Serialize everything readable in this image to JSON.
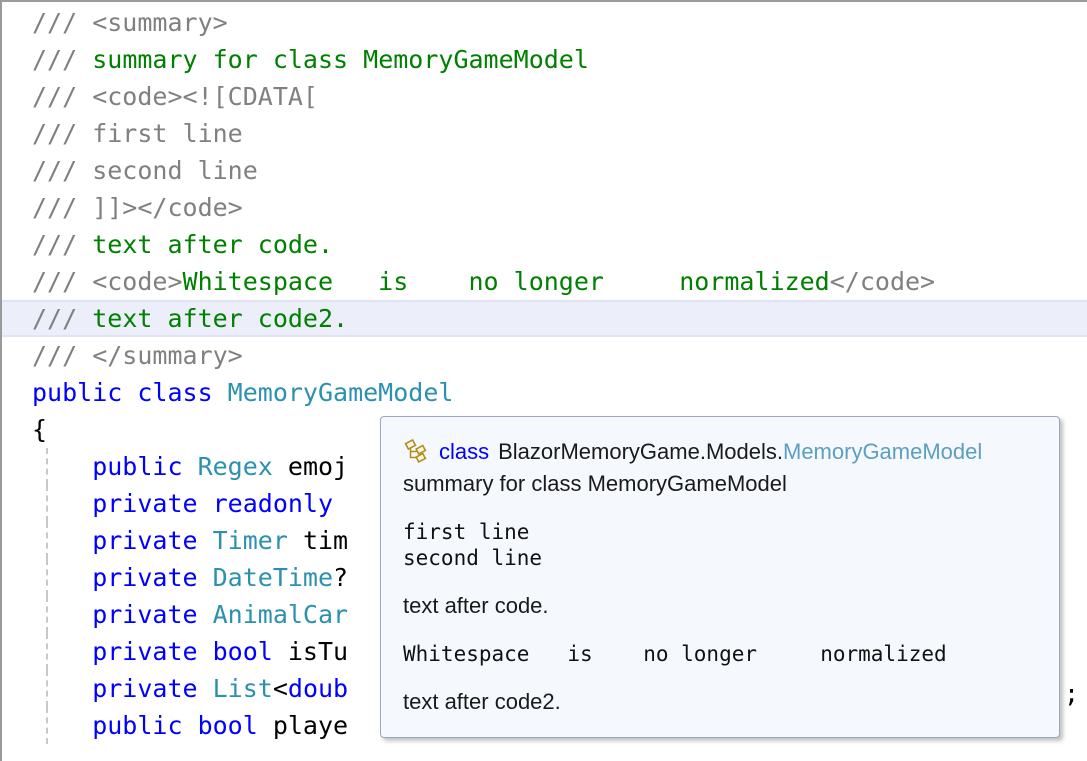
{
  "editor": {
    "lines": [
      {
        "id": "line-summary-open",
        "current": false,
        "guide": false,
        "tokens": [
          {
            "t": "cmt",
            "v": "/// <summary>"
          }
        ]
      },
      {
        "id": "line-summary-text",
        "current": false,
        "guide": false,
        "tokens": [
          {
            "t": "cmt",
            "v": "/// "
          },
          {
            "t": "doc",
            "v": "summary for class MemoryGameModel"
          }
        ]
      },
      {
        "id": "line-code-cdata-open",
        "current": false,
        "guide": false,
        "tokens": [
          {
            "t": "cmt",
            "v": "/// <code><![CDATA["
          }
        ]
      },
      {
        "id": "line-first-line",
        "current": false,
        "guide": false,
        "tokens": [
          {
            "t": "cmt",
            "v": "/// first line"
          }
        ]
      },
      {
        "id": "line-second-line",
        "current": false,
        "guide": false,
        "tokens": [
          {
            "t": "cmt",
            "v": "/// second line"
          }
        ]
      },
      {
        "id": "line-cdata-close",
        "current": false,
        "guide": false,
        "tokens": [
          {
            "t": "cmt",
            "v": "/// ]]></code>"
          }
        ]
      },
      {
        "id": "line-text-after-code",
        "current": false,
        "guide": false,
        "tokens": [
          {
            "t": "cmt",
            "v": "/// "
          },
          {
            "t": "doc",
            "v": "text after code."
          }
        ]
      },
      {
        "id": "line-whitespace-code",
        "current": false,
        "guide": false,
        "tokens": [
          {
            "t": "cmt",
            "v": "/// <code>"
          },
          {
            "t": "doc",
            "v": "Whitespace   is    no longer     normalized"
          },
          {
            "t": "cmt",
            "v": "</code>"
          }
        ]
      },
      {
        "id": "line-text-after-code2",
        "current": true,
        "guide": false,
        "tokens": [
          {
            "t": "cmt",
            "v": "/// "
          },
          {
            "t": "doc",
            "v": "text after code2."
          }
        ]
      },
      {
        "id": "line-summary-close",
        "current": false,
        "guide": false,
        "tokens": [
          {
            "t": "cmt",
            "v": "/// </summary>"
          }
        ]
      },
      {
        "id": "line-class-decl",
        "current": false,
        "guide": false,
        "tokens": [
          {
            "t": "kw",
            "v": "public class "
          },
          {
            "t": "type",
            "v": "MemoryGameModel"
          }
        ]
      },
      {
        "id": "line-open-brace",
        "current": false,
        "guide": false,
        "tokens": [
          {
            "t": "punct",
            "v": "{"
          }
        ]
      },
      {
        "id": "line-field-emoji",
        "current": false,
        "guide": true,
        "tokens": [
          {
            "t": "kw",
            "v": "    public "
          },
          {
            "t": "type",
            "v": "Regex "
          },
          {
            "t": "id",
            "v": "emoj"
          }
        ]
      },
      {
        "id": "line-field-readonly",
        "current": false,
        "guide": true,
        "tokens": [
          {
            "t": "kw",
            "v": "    private readonly "
          }
        ]
      },
      {
        "id": "line-field-timer",
        "current": false,
        "guide": true,
        "tokens": [
          {
            "t": "kw",
            "v": "    private "
          },
          {
            "t": "type",
            "v": "Timer "
          },
          {
            "t": "id",
            "v": "tim"
          }
        ]
      },
      {
        "id": "line-field-datetime",
        "current": false,
        "guide": true,
        "tokens": [
          {
            "t": "kw",
            "v": "    private "
          },
          {
            "t": "type",
            "v": "DateTime"
          },
          {
            "t": "punct",
            "v": "?"
          }
        ]
      },
      {
        "id": "line-field-animalcard",
        "current": false,
        "guide": true,
        "tokens": [
          {
            "t": "kw",
            "v": "    private "
          },
          {
            "t": "type",
            "v": "AnimalCar"
          }
        ]
      },
      {
        "id": "line-field-isturn",
        "current": false,
        "guide": true,
        "tokens": [
          {
            "t": "kw",
            "v": "    private bool "
          },
          {
            "t": "id",
            "v": "isTu"
          }
        ]
      },
      {
        "id": "line-field-list",
        "current": false,
        "guide": true,
        "tokens": [
          {
            "t": "kw",
            "v": "    private "
          },
          {
            "t": "type",
            "v": "List"
          },
          {
            "t": "punct",
            "v": "<"
          },
          {
            "t": "kw",
            "v": "doub"
          }
        ]
      },
      {
        "id": "line-field-player",
        "current": false,
        "guide": true,
        "tokens": [
          {
            "t": "kw",
            "v": "    public bool "
          },
          {
            "t": "id",
            "v": "playe"
          }
        ]
      }
    ],
    "trailing_semicolon": ";"
  },
  "tooltip": {
    "icon_name": "class-icon",
    "keyword": "class",
    "namespace": "BlazorMemoryGame.Models.",
    "class_name": "MemoryGameModel",
    "summary": "summary for class MemoryGameModel",
    "code_block_1": "first line\nsecond line",
    "paragraph_1": "text after code.",
    "code_block_2": "Whitespace   is    no longer     normalized",
    "paragraph_2": "text after code2."
  },
  "colors": {
    "comment": "#808080",
    "doc_text": "#008000",
    "keyword": "#0000ff",
    "type": "#2b91af",
    "tooltip_bg": "#f5f8fd",
    "tooltip_border": "#9aa7bd",
    "current_line_bg": "#eceefa",
    "class_icon": "#b08d1e"
  }
}
